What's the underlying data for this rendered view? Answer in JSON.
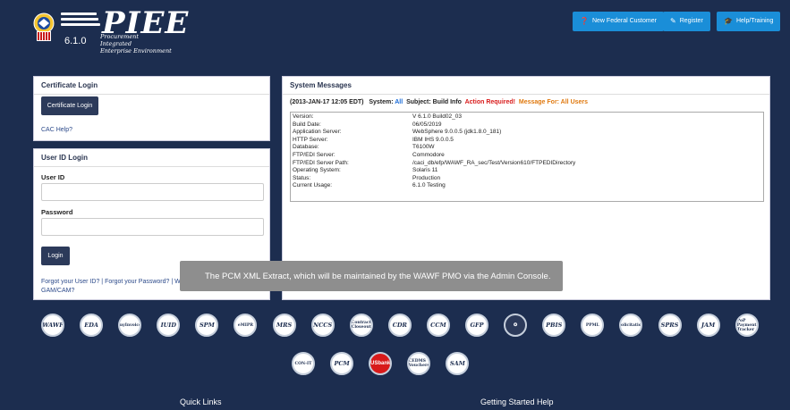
{
  "header": {
    "title": "PIEE",
    "version": "6.1.0",
    "subtitle_line1": "Procurement Integrated",
    "subtitle_line2": "Enterprise Environment",
    "buttons": [
      {
        "label": "New Federal Customer",
        "icon": "question-circle-icon"
      },
      {
        "label": "Register",
        "icon": "pencil-icon"
      },
      {
        "label": "Help/Training",
        "icon": "graduation-cap-icon"
      }
    ]
  },
  "certificate_login": {
    "title": "Certificate Login",
    "button_label": "Certificate Login",
    "cac_help": "CAC Help?"
  },
  "user_login": {
    "title": "User ID Login",
    "user_id_label": "User ID",
    "user_id_value": "",
    "password_label": "Password",
    "password_value": "",
    "login_label": "Login",
    "forgot_text": "Forgot your User ID? | Forgot your Password? | Wh",
    "gam_text": "GAM/CAM?"
  },
  "system_messages": {
    "title": "System Messages",
    "header_date": "(2013-JAN-17 12:05 EDT)",
    "system_label": "System:",
    "system_value": "All",
    "subject_label": "Subject:",
    "subject_value": "Build Info",
    "action_required": "Action Required!",
    "message_for": "Message For: All Users",
    "rows": [
      {
        "key": "Version:",
        "value": "V 6.1.0 Build02_03"
      },
      {
        "key": "Build Date:",
        "value": "06/05/2019"
      },
      {
        "key": "Application Server:",
        "value": "WebSphere 9.0.0.5 (jdk1.8.0_181)"
      },
      {
        "key": "HTTP Server:",
        "value": "IBM IHS 9.0.0.5"
      },
      {
        "key": "Database:",
        "value": "T6100W"
      },
      {
        "key": "FTP/EDI Server:",
        "value": "Commodore"
      },
      {
        "key": "FTP/EDI Server Path:",
        "value": "/caci_db/efp/WAWF_RA_sec/Test/Version610/FTPEDIDirectory"
      },
      {
        "key": "Operating System:",
        "value": "Solaris 11"
      },
      {
        "key": "Status:",
        "value": "Production"
      },
      {
        "key": "Current Usage:",
        "value": "6.1.0 Testing"
      }
    ]
  },
  "toast": {
    "text": "The PCM XML Extract, which will be maintained by the WAWF PMO via the Admin Console."
  },
  "apps_row1": [
    "WAWF",
    "EDA",
    "myInvoice",
    "IUID",
    "SPM",
    "eMIPR",
    "MRS",
    "NCCS",
    "Contract Closeout",
    "CDR",
    "CCM",
    "GFP",
    "",
    "PBIS",
    "PPML",
    "Solicitation",
    "SPRS",
    "JAM",
    "PoP Payment Tracker"
  ],
  "apps_row2": [
    "CON-IT",
    "PCM",
    "USbank",
    "CEDMS Vouchers",
    "SAM"
  ],
  "footer": {
    "quick_links": "Quick Links",
    "getting_started": "Getting Started Help"
  }
}
